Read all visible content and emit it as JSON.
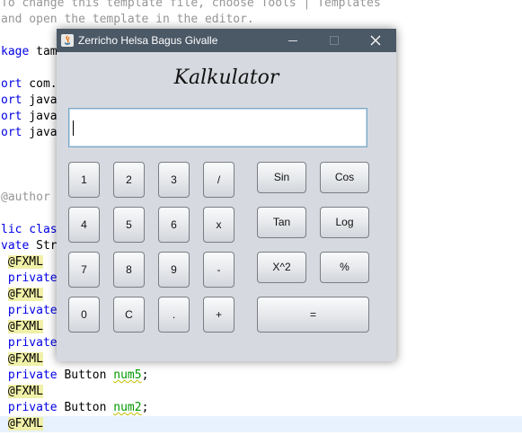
{
  "editor": {
    "lines": [
      {
        "text": "To change this template file, choose Tools | Templates",
        "type": "comment"
      },
      {
        "text": "and open the template in the editor.",
        "type": "comment"
      },
      {
        "text": "",
        "type": "plain"
      },
      {
        "text": "kage tam",
        "type": "kwstart",
        "kw": "kage",
        "rest": " tam"
      },
      {
        "text": "",
        "type": "plain"
      },
      {
        "text": "ort com.",
        "type": "kwstart",
        "kw": "ort",
        "rest": " com."
      },
      {
        "text": "ort java",
        "type": "kwstart",
        "kw": "ort",
        "rest": " java"
      },
      {
        "text": "ort java",
        "type": "kwstart",
        "kw": "ort",
        "rest": " java"
      },
      {
        "text": "ort java",
        "type": "kwstart",
        "kw": "ort",
        "rest": " java"
      },
      {
        "text": "",
        "type": "plain"
      },
      {
        "text": "",
        "type": "plain"
      },
      {
        "text": "",
        "type": "plain"
      },
      {
        "text": "@author ",
        "type": "comment"
      },
      {
        "text": "",
        "type": "plain"
      },
      {
        "text": "lic clas",
        "type": "kwstart",
        "kw": "lic clas",
        "rest": ""
      },
      {
        "text": "vate Str",
        "type": "kwstart",
        "kw": "vate",
        "rest": " Str"
      },
      {
        "text": " @FXML",
        "type": "ann"
      },
      {
        "text": " private",
        "type": "kwstart",
        "kw": " private",
        "rest": ""
      },
      {
        "text": " @FXML",
        "type": "ann"
      },
      {
        "text": " private",
        "type": "kwstart",
        "kw": " private",
        "rest": ""
      },
      {
        "text": " @FXML",
        "type": "ann"
      },
      {
        "text": " private",
        "type": "kwstart",
        "kw": " private",
        "rest": ""
      },
      {
        "text": " @FXML",
        "type": "ann"
      },
      {
        "text": " private Button num5;",
        "type": "field",
        "kw": " private",
        "mid": " Button ",
        "var": "num5",
        "end": ";"
      },
      {
        "text": " @FXML",
        "type": "ann"
      },
      {
        "text": " private Button num2;",
        "type": "field",
        "kw": " private",
        "mid": " Button ",
        "var": "num2",
        "end": ";"
      },
      {
        "text": " @FXML",
        "type": "ann",
        "highlight": true
      }
    ]
  },
  "window": {
    "title": "Zerricho Helsa Bagus Givalle",
    "heading": "Kalkulator",
    "display_value": ""
  },
  "buttons": {
    "n1": "1",
    "n2": "2",
    "n3": "3",
    "div": "/",
    "n4": "4",
    "n5": "5",
    "n6": "6",
    "mul": "x",
    "n7": "7",
    "n8": "8",
    "n9": "9",
    "sub": "-",
    "n0": "0",
    "clear": "C",
    "dot": ".",
    "add": "+",
    "sin": "Sin",
    "cos": "Cos",
    "tan": "Tan",
    "log": "Log",
    "sq": "X^2",
    "pct": "%",
    "eq": "="
  },
  "colors": {
    "titlebar": "#4b5866",
    "window_bg": "#d6d9df",
    "display_border": "#7aa7c7"
  }
}
